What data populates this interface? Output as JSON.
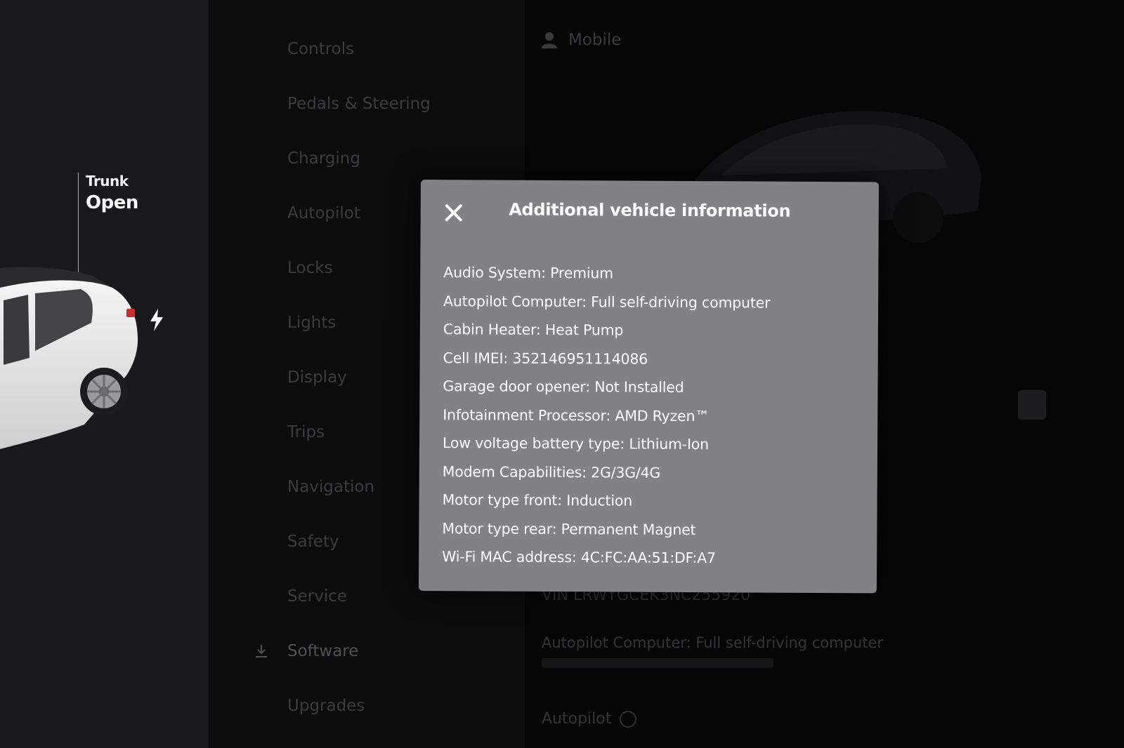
{
  "car_panel": {
    "trunk_label": "Trunk",
    "trunk_status": "Open"
  },
  "settings_nav": {
    "items": [
      {
        "label": "Controls",
        "icon": "toggle-icon"
      },
      {
        "label": "Pedals & Steering",
        "icon": "steering-icon"
      },
      {
        "label": "Charging",
        "icon": "charging-icon"
      },
      {
        "label": "Autopilot",
        "icon": "steering-wheel-icon"
      },
      {
        "label": "Locks",
        "icon": "lock-icon"
      },
      {
        "label": "Lights",
        "icon": "light-icon"
      },
      {
        "label": "Display",
        "icon": "display-icon"
      },
      {
        "label": "Trips",
        "icon": "trips-icon"
      },
      {
        "label": "Navigation",
        "icon": "navigation-icon"
      },
      {
        "label": "Safety",
        "icon": "shield-icon"
      },
      {
        "label": "Service",
        "icon": "wrench-icon"
      },
      {
        "label": "Software",
        "icon": "download-icon"
      },
      {
        "label": "Upgrades",
        "icon": "bag-icon"
      }
    ]
  },
  "detail": {
    "profile_name": "Mobile",
    "vin": "VIN LRWYGCEK3NC255920",
    "autopilot_computer": "Autopilot Computer: Full self-driving computer",
    "autopilot_link": "Autopilot"
  },
  "modal": {
    "title": "Additional vehicle information",
    "items": [
      "Audio System: Premium",
      "Autopilot Computer: Full self-driving computer",
      "Cabin Heater: Heat Pump",
      "Cell IMEI: 352146951114086",
      "Garage door opener: Not Installed",
      "Infotainment Processor: AMD Ryzen™",
      "Low voltage battery type: Lithium-Ion",
      "Modem Capabilities: 2G/3G/4G",
      "Motor type front: Induction",
      "Motor type rear: Permanent Magnet",
      "Wi-Fi MAC address: 4C:FC:AA:51:DF:A7"
    ]
  },
  "colors": {
    "modal_bg": "#828284",
    "left_panel_bg": "#19191b",
    "dimmed_text": "#3c3c3f"
  }
}
